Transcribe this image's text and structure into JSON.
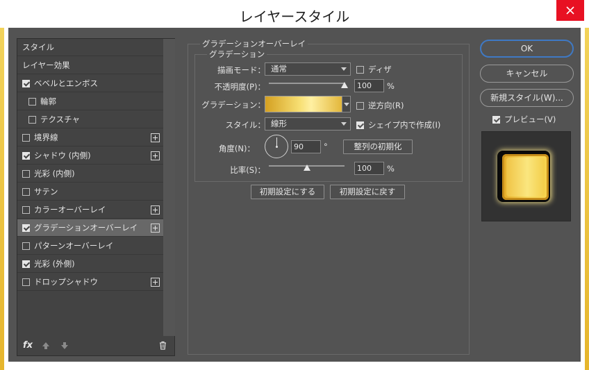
{
  "window": {
    "title": "レイヤースタイル"
  },
  "colors": {
    "accent": "#e81123",
    "ok_border": "#3f79c4",
    "panel_bg": "#535353"
  },
  "styles_panel": {
    "items": [
      {
        "label": "スタイル",
        "checkbox": false,
        "checked": false,
        "plus": false
      },
      {
        "label": "レイヤー効果",
        "checkbox": false,
        "checked": false,
        "plus": false
      },
      {
        "label": "ベベルとエンボス",
        "checkbox": true,
        "checked": true,
        "plus": false
      },
      {
        "label": "輪郭",
        "checkbox": true,
        "checked": false,
        "plus": false,
        "indent": true
      },
      {
        "label": "テクスチャ",
        "checkbox": true,
        "checked": false,
        "plus": false,
        "indent": true
      },
      {
        "label": "境界線",
        "checkbox": true,
        "checked": false,
        "plus": true
      },
      {
        "label": "シャドウ (内側)",
        "checkbox": true,
        "checked": true,
        "plus": true
      },
      {
        "label": "光彩 (内側)",
        "checkbox": true,
        "checked": false,
        "plus": false
      },
      {
        "label": "サテン",
        "checkbox": true,
        "checked": false,
        "plus": false
      },
      {
        "label": "カラーオーバーレイ",
        "checkbox": true,
        "checked": false,
        "plus": true
      },
      {
        "label": "グラデーションオーバーレイ",
        "checkbox": true,
        "checked": true,
        "plus": true,
        "selected": true
      },
      {
        "label": "パターンオーバーレイ",
        "checkbox": true,
        "checked": false,
        "plus": false
      },
      {
        "label": "光彩 (外側)",
        "checkbox": true,
        "checked": true,
        "plus": false
      },
      {
        "label": "ドロップシャドウ",
        "checkbox": true,
        "checked": false,
        "plus": true
      }
    ],
    "fx_label": "fx"
  },
  "gradient_overlay": {
    "section_title": "グラデーションオーバーレイ",
    "group_title": "グラデーション",
    "blend_mode_label": "描画モード：",
    "blend_mode_value": "通常",
    "dither_label": "ディザ",
    "opacity_label": "不透明度(P)：",
    "opacity_value": "100",
    "opacity_unit": "%",
    "opacity_fraction": 1.0,
    "gradient_label": "グラデーション：",
    "reverse_label": "逆方向(R)",
    "style_label": "スタイル：",
    "style_value": "線形",
    "align_layer_label": "シェイプ内で作成(I)",
    "angle_label": "角度(N)：",
    "angle_value": "90",
    "angle_unit": "°",
    "reset_alignment_label": "整列の初期化",
    "scale_label": "比率(S)：",
    "scale_value": "100",
    "scale_unit": "%",
    "scale_fraction": 0.5,
    "make_default_label": "初期設定にする",
    "reset_default_label": "初期設定に戻す"
  },
  "right_panel": {
    "ok_label": "OK",
    "cancel_label": "キャンセル",
    "new_style_label": "新規スタイル(W)...",
    "preview_label": "プレビュー(V)",
    "preview_checked": true
  }
}
